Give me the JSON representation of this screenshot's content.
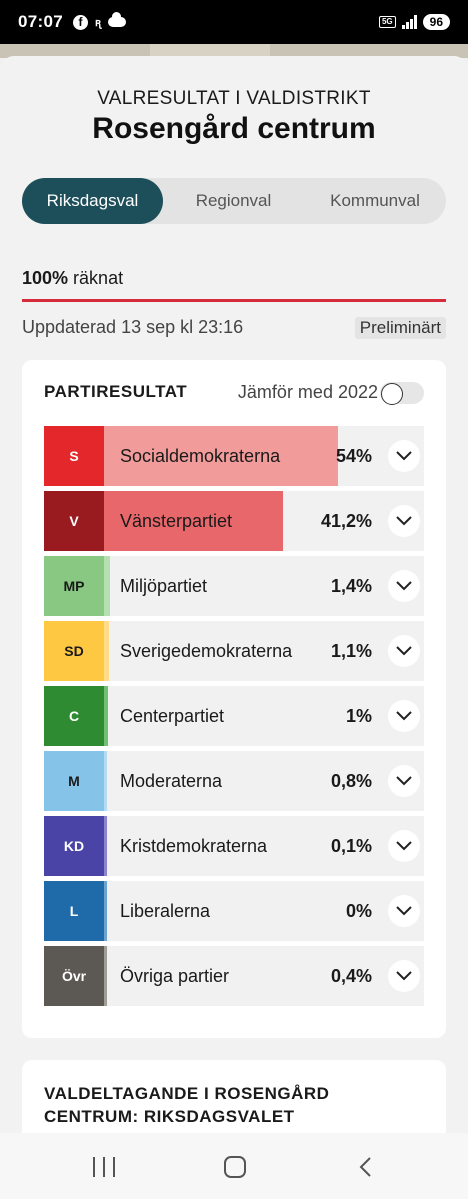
{
  "status_bar": {
    "time": "07:07",
    "fb_glyph": "f",
    "misc_glyph": "ꭆ",
    "network": "5G",
    "battery": "96",
    "icons": [
      "facebook-icon",
      "notification-icon",
      "cloud-icon",
      "signal-icon",
      "battery-icon"
    ]
  },
  "header": {
    "pretitle": "VALRESULTAT I VALDISTRIKT",
    "title": "Rosengård centrum"
  },
  "tabs": [
    {
      "label": "Riksdagsval",
      "active": true
    },
    {
      "label": "Regionval",
      "active": false
    },
    {
      "label": "Kommunval",
      "active": false
    }
  ],
  "count": {
    "percent": "100%",
    "label": " räknat",
    "progress": 1.0
  },
  "updated": "Uppdaterad 13 sep kl 23:16",
  "status_badge": "Preliminärt",
  "results": {
    "heading": "PARTIRESULTAT",
    "compare_label": "Jämför med 2022",
    "compare_enabled": false,
    "parties": [
      {
        "abbr": "S",
        "name": "Socialdemokraterna",
        "pct": "54%",
        "share": 54,
        "color": "#e3272b",
        "bar": "#f29b9b",
        "dark_text": false
      },
      {
        "abbr": "V",
        "name": "Vänsterpartiet",
        "pct": "41,2%",
        "share": 41.2,
        "color": "#9a1b1f",
        "bar": "#e8676a",
        "dark_text": false
      },
      {
        "abbr": "MP",
        "name": "Miljöpartiet",
        "pct": "1,4%",
        "share": 1.4,
        "color": "#88c883",
        "bar": "#b5deb1",
        "dark_text": true
      },
      {
        "abbr": "SD",
        "name": "Sverigedemokraterna",
        "pct": "1,1%",
        "share": 1.1,
        "color": "#ffc843",
        "bar": "#ffdd88",
        "dark_text": true
      },
      {
        "abbr": "C",
        "name": "Centerpartiet",
        "pct": "1%",
        "share": 1,
        "color": "#2e8b32",
        "bar": "#6fc072",
        "dark_text": false
      },
      {
        "abbr": "M",
        "name": "Moderaterna",
        "pct": "0,8%",
        "share": 0.8,
        "color": "#85c3e8",
        "bar": "#b3dbf2",
        "dark_text": true
      },
      {
        "abbr": "KD",
        "name": "Kristdemokraterna",
        "pct": "0,1%",
        "share": 0.1,
        "color": "#4a44a6",
        "bar": "#8a85cc",
        "dark_text": false
      },
      {
        "abbr": "L",
        "name": "Liberalerna",
        "pct": "0%",
        "share": 0,
        "color": "#1f6aa8",
        "bar": "#6ea3d0",
        "dark_text": false
      },
      {
        "abbr": "Övr",
        "name": "Övriga partier",
        "pct": "0,4%",
        "share": 0.4,
        "color": "#5c5954",
        "bar": "#a09c96",
        "dark_text": false
      }
    ]
  },
  "turnout": {
    "heading": "VALDELTAGANDE I ROSENGÅRD CENTRUM: RIKSDAGSVALET"
  },
  "navbar": {
    "icons": [
      "recent-apps-icon",
      "home-icon",
      "back-icon"
    ]
  }
}
